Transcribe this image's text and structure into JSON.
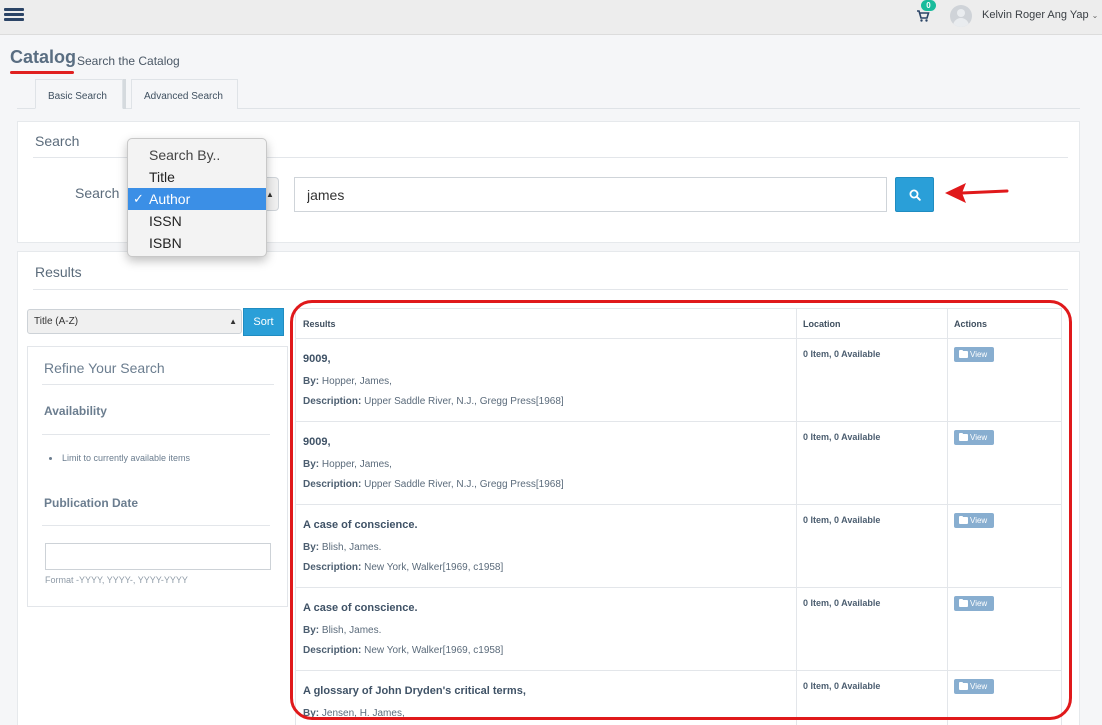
{
  "topbar": {
    "cart_count": "0",
    "user_name": "Kelvin Roger Ang Yap"
  },
  "page": {
    "title": "Catalog",
    "subtitle": "Search the Catalog"
  },
  "tabs": [
    {
      "label": "Basic Search",
      "active": true
    },
    {
      "label": "Advanced Search",
      "active": false
    }
  ],
  "search": {
    "heading": "Search",
    "field_label": "Search",
    "dropdown_options": [
      "Search By..",
      "Title",
      "Author",
      "ISSN",
      "ISBN"
    ],
    "selected_option": "Author",
    "check_mark": "✓",
    "query": "james"
  },
  "results": {
    "heading": "Results",
    "sort_value": "Title (A-Z)",
    "sort_button": "Sort",
    "columns": [
      "Results",
      "Location",
      "Actions"
    ],
    "by_label": "By:",
    "description_label": "Description:",
    "view_label": "View",
    "items": [
      {
        "title": "9009,",
        "by": "Hopper, James,",
        "description": "Upper Saddle River, N.J., Gregg Press[1968]",
        "location": "0 Item, 0 Available"
      },
      {
        "title": "9009,",
        "by": "Hopper, James,",
        "description": "Upper Saddle River, N.J., Gregg Press[1968]",
        "location": "0 Item, 0 Available"
      },
      {
        "title": "A case of conscience.",
        "by": "Blish, James.",
        "description": "New York, Walker[1969, c1958]",
        "location": "0 Item, 0 Available"
      },
      {
        "title": "A case of conscience.",
        "by": "Blish, James.",
        "description": "New York, Walker[1969, c1958]",
        "location": "0 Item, 0 Available"
      },
      {
        "title": "A glossary of John Dryden's critical terms,",
        "by": "Jensen, H. James,",
        "description": "",
        "location": "0 Item, 0 Available"
      }
    ]
  },
  "refine": {
    "title": "Refine Your Search",
    "availability_label": "Availability",
    "availability_link": "Limit to currently available items",
    "pubdate_label": "Publication Date",
    "date_value": "",
    "date_hint": "Format -YYYY, YYYY-, YYYY-YYYY"
  },
  "colors": {
    "accent": "#2a9fd8",
    "annotation_red": "#e0191b",
    "selected_option_bg": "#3b8fe6",
    "cart_badge": "#1abc9c"
  }
}
